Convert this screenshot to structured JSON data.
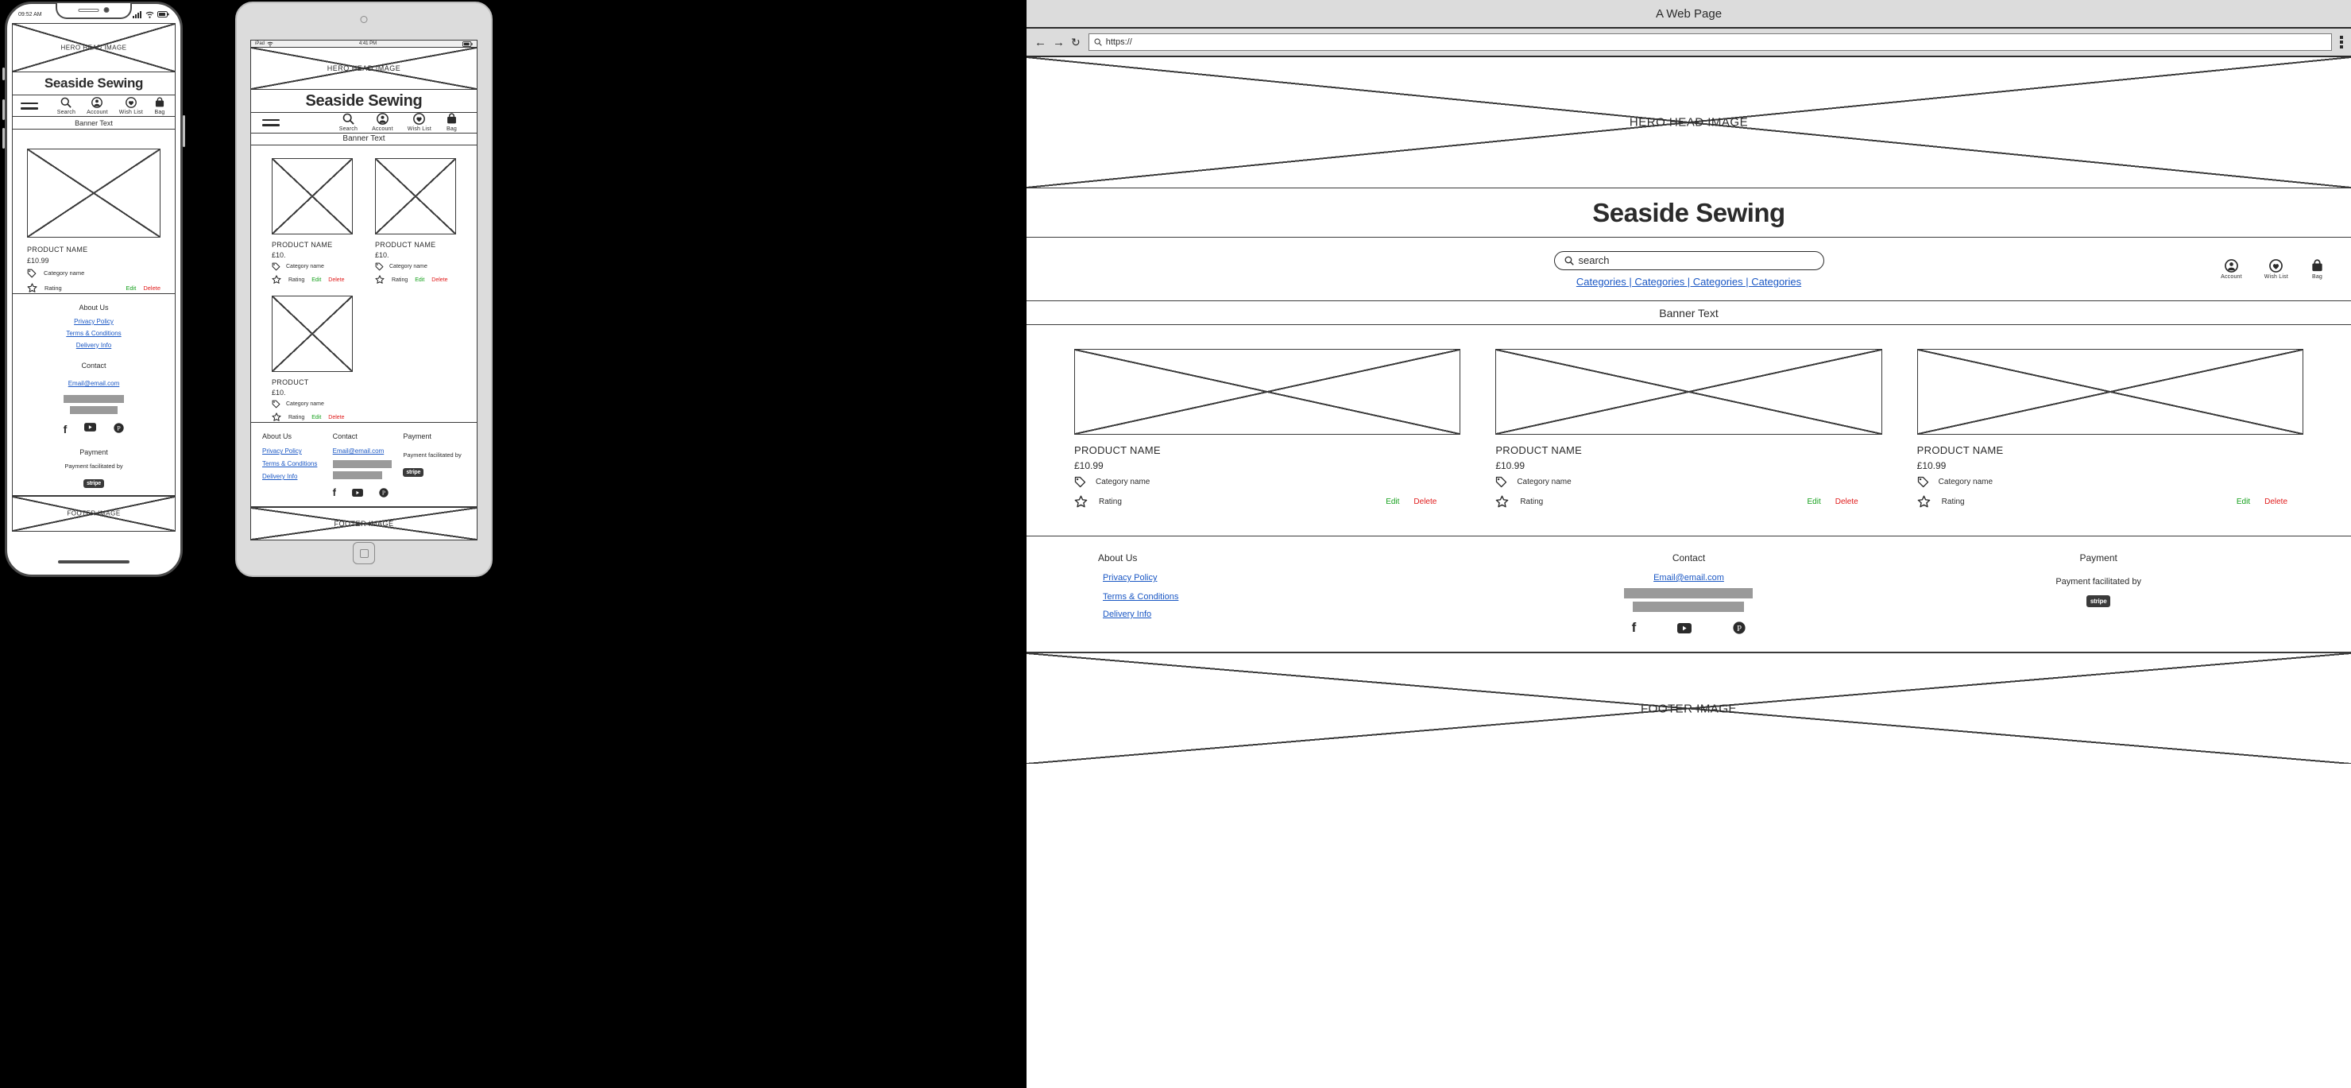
{
  "brand": {
    "name": "Seaside Sewing"
  },
  "labels": {
    "hero_image": "HERO HEAD IMAGE",
    "footer_image": "FOOTER IMAGE",
    "banner_text": "Banner Text",
    "about_us": "About Us",
    "contact": "Contact",
    "payment": "Payment",
    "payment_facilitated": "Payment facilitated by",
    "stripe": "stripe",
    "email": "Email@email.com",
    "privacy": "Privacy Policy",
    "terms": "Terms & Conditions",
    "delivery": "Delivery Info",
    "categories_links": "Categories | Categories | Categories | Categories",
    "rating": "Rating",
    "category_name": "Category name",
    "edit": "Edit",
    "delete": "Delete"
  },
  "nav_icons": [
    {
      "name": "search",
      "label": "Search"
    },
    {
      "name": "account",
      "label": "Account"
    },
    {
      "name": "wishlist",
      "label": "Wish List"
    },
    {
      "name": "bag",
      "label": "Bag"
    }
  ],
  "desktop_nav_icons": [
    {
      "name": "account",
      "label": "Account"
    },
    {
      "name": "wishlist",
      "label": "Wish List"
    },
    {
      "name": "bag",
      "label": "Bag"
    }
  ],
  "phone": {
    "status_time": "09:52 AM",
    "signal_icon": "signal-bars-icon",
    "wifi_icon": "wifi-icon",
    "battery_icon": "battery-icon",
    "products": [
      {
        "name": "PRODUCT NAME",
        "price": "£10.99",
        "category": "Category name",
        "rating": "Rating",
        "edit": "Edit",
        "delete": "Delete"
      }
    ]
  },
  "tablet": {
    "status_device": "iPad",
    "status_time": "4:41 PM",
    "wifi_icon": "wifi-icon",
    "battery_icon": "battery-icon",
    "products": [
      {
        "name": "PRODUCT NAME",
        "price": "£10.",
        "category": "Category name",
        "rating": "Rating",
        "edit": "Edit",
        "delete": "Delete"
      },
      {
        "name": "PRODUCT NAME",
        "price": "£10.",
        "category": "Category name",
        "rating": "Rating",
        "edit": "Edit",
        "delete": "Delete"
      },
      {
        "name": "PRODUCT",
        "price": "£10.",
        "category": "Category name",
        "rating": "Rating",
        "edit": "Edit",
        "delete": "Delete"
      }
    ]
  },
  "desktop": {
    "window_title": "A Web Page",
    "url_value": "https://",
    "url_placeholder": "https://",
    "search_placeholder": "search",
    "search_value": "search",
    "back_icon": "arrow-left-icon",
    "forward_icon": "arrow-right-icon",
    "reload_icon": "reload-icon",
    "menu_icon": "menu-grid-icon",
    "products": [
      {
        "name": "PRODUCT NAME",
        "price": "£10.99",
        "category": "Category name",
        "rating": "Rating",
        "edit": "Edit",
        "delete": "Delete"
      },
      {
        "name": "PRODUCT NAME",
        "price": "£10.99",
        "category": "Category name",
        "rating": "Rating",
        "edit": "Edit",
        "delete": "Delete"
      },
      {
        "name": "PRODUCT NAME",
        "price": "£10.99",
        "category": "Category name",
        "rating": "Rating",
        "edit": "Edit",
        "delete": "Delete"
      }
    ]
  },
  "social": [
    {
      "name": "facebook",
      "glyph": "f"
    },
    {
      "name": "youtube",
      "glyph": "▶"
    },
    {
      "name": "pinterest",
      "glyph": "P"
    }
  ],
  "colors": {
    "link": "#1a57c4",
    "edit": "#15a01c",
    "delete": "#e01b1b",
    "ink": "#2b2b2b",
    "line": "#3a3a3a",
    "bg": "#000000"
  }
}
